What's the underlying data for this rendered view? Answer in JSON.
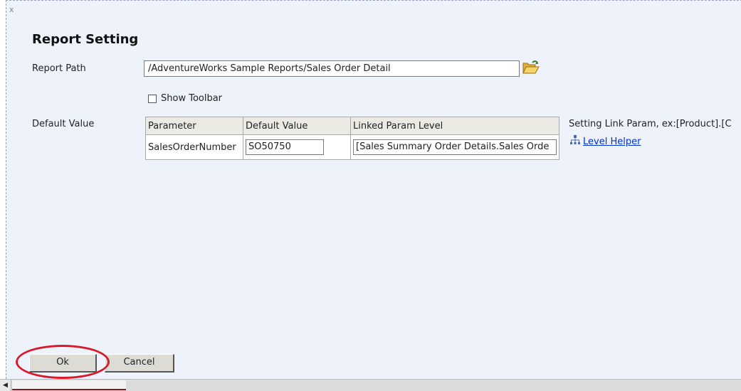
{
  "dialog": {
    "close_label": "x",
    "title": "Report Setting"
  },
  "report_path": {
    "label": "Report Path",
    "value": "/AdventureWorks Sample Reports/Sales Order Detail",
    "browse_icon": "folder-open-icon"
  },
  "show_toolbar": {
    "label": "Show Toolbar",
    "checked": false
  },
  "default_value": {
    "label": "Default Value",
    "columns": [
      "Parameter",
      "Default Value",
      "Linked Param Level"
    ],
    "rows": [
      {
        "parameter": "SalesOrderNumber",
        "default_value": "SO50750",
        "linked_level": "[Sales Summary Order Details.Sales Orde"
      }
    ]
  },
  "help": {
    "text": "Setting Link Param, ex:[Product].[C",
    "level_helper_label": "Level Helper",
    "level_helper_icon": "hierarchy-icon"
  },
  "buttons": {
    "ok": "Ok",
    "cancel": "Cancel"
  },
  "colors": {
    "dialog_bg": "#eef2fb",
    "highlight_circle": "#d8192a",
    "link": "#0033cc"
  }
}
